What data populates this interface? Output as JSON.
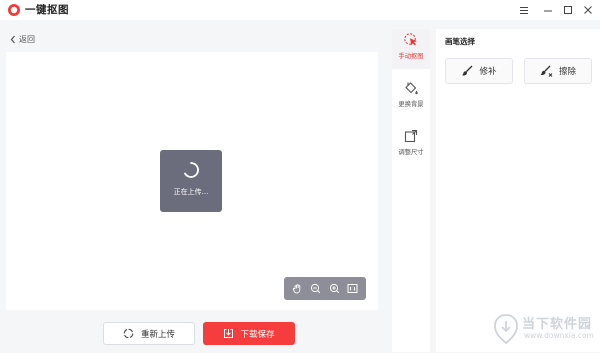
{
  "app": {
    "title": "一键抠图"
  },
  "window_controls": [
    "menu-icon",
    "minimize-icon",
    "maximize-icon",
    "close-icon"
  ],
  "nav": {
    "back_label": "返回"
  },
  "canvas": {
    "status_text": "正在上传..."
  },
  "zoom_tools": [
    "hand-icon",
    "zoom-out-icon",
    "zoom-in-icon",
    "actual-size-icon"
  ],
  "actions": {
    "reupload_label": "重新上传",
    "save_label": "下载保存"
  },
  "tools": [
    {
      "label": "手动抠图",
      "icon": "cursor-click-icon",
      "active": true
    },
    {
      "label": "更换背景",
      "icon": "paint-bucket-icon",
      "active": false
    },
    {
      "label": "调整尺寸",
      "icon": "resize-icon",
      "active": false
    }
  ],
  "panel": {
    "title": "画笔选择",
    "brushes": [
      {
        "label": "修补",
        "icon": "brush-icon"
      },
      {
        "label": "擦除",
        "icon": "eraser-brush-icon"
      }
    ]
  },
  "watermark": {
    "cn": "当下软件园",
    "en": "www.downxia.com"
  },
  "colors": {
    "accent": "#f53d3d",
    "overlay": "#6b6c7c",
    "zoom_bar": "#8d8e98"
  }
}
